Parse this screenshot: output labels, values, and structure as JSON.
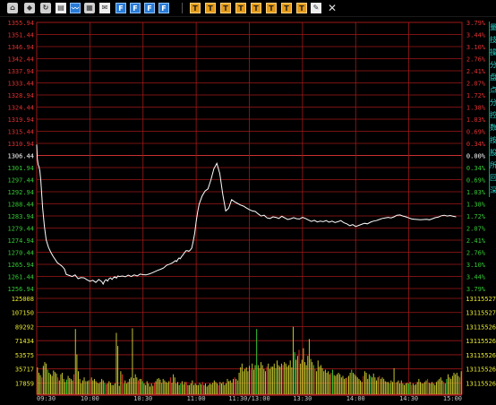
{
  "toolbar": {
    "buttons": [
      {
        "name": "home-icon",
        "cls": "a",
        "glyph": "⌂"
      },
      {
        "name": "layers-icon",
        "cls": "a",
        "glyph": "◆"
      },
      {
        "name": "refresh-icon",
        "cls": "a",
        "glyph": "↻"
      },
      {
        "name": "document-icon",
        "cls": "w",
        "glyph": "▤"
      },
      {
        "name": "chart-view-icon",
        "cls": "b",
        "glyph": "〰"
      },
      {
        "name": "grid-icon",
        "cls": "a",
        "glyph": "▦"
      },
      {
        "name": "mail-icon",
        "cls": "w",
        "glyph": "✉"
      },
      {
        "name": "f1-icon",
        "cls": "b",
        "glyph": "F"
      },
      {
        "name": "f2-icon",
        "cls": "b",
        "glyph": "F"
      },
      {
        "name": "f3-icon",
        "cls": "b",
        "glyph": "F"
      },
      {
        "name": "f4-icon",
        "cls": "b",
        "glyph": "F"
      },
      {
        "name": "tool-1-icon",
        "cls": "o",
        "glyph": "T"
      },
      {
        "name": "tool-2-icon",
        "cls": "o",
        "glyph": "T"
      },
      {
        "name": "tool-3-icon",
        "cls": "o",
        "glyph": "T"
      },
      {
        "name": "tool-4-icon",
        "cls": "o",
        "glyph": "T"
      },
      {
        "name": "tool-5-icon",
        "cls": "o",
        "glyph": "T"
      },
      {
        "name": "tool-6-icon",
        "cls": "o",
        "glyph": "T"
      },
      {
        "name": "tool-7-icon",
        "cls": "o",
        "glyph": "T"
      },
      {
        "name": "tool-8-icon",
        "cls": "o",
        "glyph": "T"
      },
      {
        "name": "tool-9-icon",
        "cls": "o",
        "glyph": "T"
      },
      {
        "name": "pencil-icon",
        "cls": "w",
        "glyph": "✎"
      },
      {
        "name": "close-icon",
        "cls": "x",
        "glyph": "✕"
      }
    ]
  },
  "side_tabs": [
    "量",
    "技",
    "操",
    "分",
    "盘",
    "点",
    "分",
    "控",
    "数",
    "按",
    "股",
    "所",
    "回",
    "深"
  ],
  "colors": {
    "up": "#e03030",
    "down": "#35c835",
    "grid": "#a01818",
    "price_line": "#ffffff",
    "volume_bar": "#c8c830",
    "volume_up": "#e03030",
    "volume_down": "#35c835",
    "reference": "#ffffff"
  },
  "chart_data": [
    {
      "type": "line",
      "name": "price",
      "reference_price": 1306.44,
      "left_ticks": [
        "1355.94",
        "1351.44",
        "1346.94",
        "1342.44",
        "1337.94",
        "1333.44",
        "1328.94",
        "1324.44",
        "1319.94",
        "1315.44",
        "1310.94",
        "1306.44",
        "1301.94",
        "1297.44",
        "1292.94",
        "1288.44",
        "1283.94",
        "1279.44",
        "1274.94",
        "1270.44",
        "1265.94",
        "1261.44",
        "1256.94"
      ],
      "right_ticks": [
        "3.79%",
        "3.44%",
        "3.10%",
        "2.76%",
        "2.41%",
        "2.07%",
        "1.72%",
        "1.38%",
        "1.03%",
        "0.69%",
        "0.34%",
        "0.00%",
        "0.34%",
        "0.69%",
        "1.03%",
        "1.38%",
        "1.72%",
        "2.07%",
        "2.41%",
        "2.76%",
        "3.10%",
        "3.44%",
        "3.79%"
      ],
      "ylim": [
        1256.94,
        1355.94
      ],
      "x_ticks": [
        "09:30",
        "10:00",
        "10:30",
        "11:00",
        "11:30/13:00",
        "13:30",
        "14:00",
        "14:30",
        "15:00"
      ],
      "x": [
        0,
        2,
        5,
        8,
        11,
        14,
        20,
        26,
        32,
        40,
        48,
        55,
        62,
        70,
        78,
        86,
        94,
        100,
        110,
        120,
        130,
        140,
        150,
        160,
        170,
        180,
        190,
        200,
        210,
        220,
        225,
        230,
        235,
        240,
        245,
        250,
        255,
        260,
        265,
        270,
        275,
        280,
        290,
        300,
        310,
        320,
        330,
        340,
        350,
        360,
        370,
        380,
        390,
        400,
        410,
        420,
        430,
        440,
        450,
        460,
        470,
        474,
        478,
        482,
        486,
        490,
        494,
        498,
        502,
        506,
        510,
        515,
        520,
        525,
        530,
        535,
        540,
        545,
        550,
        560,
        570,
        580,
        590,
        600,
        610,
        620,
        630,
        640,
        650,
        660,
        670,
        680,
        690,
        700,
        710,
        720,
        730,
        740,
        750,
        760,
        770,
        780,
        790,
        800,
        810,
        820,
        830,
        840,
        850,
        860,
        870,
        880,
        890,
        900,
        910,
        920,
        930,
        940,
        950,
        960,
        970,
        980,
        990,
        1000,
        1010,
        1020,
        1030,
        1040,
        1050,
        1060,
        1070,
        1080,
        1090,
        1100,
        1110,
        1120,
        1130,
        1140,
        1150,
        1160,
        1170,
        1180,
        1190,
        1200,
        1210,
        1220,
        1230,
        1240,
        1250,
        1260,
        1270,
        1280,
        1290,
        1300,
        1310,
        1320,
        1330,
        1340,
        1350,
        1360,
        1370,
        1380,
        1390,
        1400,
        1410,
        1420,
        1430,
        1440
      ],
      "price": [
        1310.5,
        1305.2,
        1303.0,
        1302.2,
        1300.5,
        1297.0,
        1287.0,
        1280.0,
        1275.0,
        1272.2,
        1270.4,
        1269.0,
        1267.8,
        1266.5,
        1265.9,
        1265.2,
        1264.2,
        1262.2,
        1261.8,
        1261.4,
        1262.0,
        1260.6,
        1261.0,
        1260.9,
        1260.2,
        1259.6,
        1260.0,
        1259.2,
        1260.3,
        1259.5,
        1258.6,
        1259.8,
        1260.2,
        1259.7,
        1260.6,
        1260.9,
        1260.3,
        1261.0,
        1261.3,
        1260.8,
        1261.6,
        1261.4,
        1261.6,
        1261.3,
        1261.9,
        1261.4,
        1262.0,
        1261.6,
        1262.3,
        1262.1,
        1262.0,
        1262.3,
        1262.7,
        1263.2,
        1263.7,
        1264.1,
        1264.6,
        1265.6,
        1266.0,
        1266.5,
        1267.3,
        1267.0,
        1267.8,
        1268.3,
        1268.0,
        1268.7,
        1269.3,
        1269.9,
        1270.5,
        1271.0,
        1271.0,
        1270.8,
        1271.2,
        1272.0,
        1274.5,
        1277.6,
        1281.8,
        1285.5,
        1288.3,
        1291.3,
        1293.2,
        1294.0,
        1297.4,
        1301.5,
        1303.5,
        1299.7,
        1292.0,
        1285.8,
        1286.8,
        1290.0,
        1289.2,
        1288.6,
        1288.0,
        1287.6,
        1286.9,
        1286.3,
        1285.8,
        1285.6,
        1284.7,
        1283.9,
        1284.2,
        1283.2,
        1283.0,
        1283.6,
        1283.4,
        1283.0,
        1283.8,
        1283.2,
        1282.6,
        1282.9,
        1283.3,
        1282.9,
        1282.8,
        1283.4,
        1283.0,
        1282.4,
        1281.9,
        1282.3,
        1281.7,
        1282.0,
        1281.8,
        1282.2,
        1281.6,
        1282.0,
        1281.5,
        1281.8,
        1282.2,
        1281.4,
        1281.0,
        1280.3,
        1280.7,
        1280.0,
        1280.4,
        1280.8,
        1281.2,
        1281.0,
        1281.6,
        1282.0,
        1282.2,
        1282.6,
        1283.0,
        1283.2,
        1283.4,
        1283.2,
        1283.6,
        1284.2,
        1284.3,
        1283.9,
        1283.6,
        1283.2,
        1282.8,
        1282.7,
        1282.6,
        1282.5,
        1282.6,
        1282.7,
        1282.5,
        1282.9,
        1283.3,
        1283.5,
        1284.0,
        1284.2,
        1283.9,
        1284.1,
        1283.8,
        1283.6
      ]
    },
    {
      "type": "bar",
      "name": "volume",
      "ylim": [
        0,
        125008
      ],
      "left_ticks": [
        "125008",
        "107150",
        "89292",
        "71434",
        "53575",
        "35717",
        "17859"
      ],
      "right_ticks": [
        "13115527",
        "13115527",
        "13115526",
        "13115526",
        "13115526",
        "13115526",
        "13115526"
      ],
      "values": [
        35000,
        28000,
        25000,
        22000,
        37000,
        42000,
        40000,
        32000,
        28000,
        26000,
        24000,
        31000,
        29000,
        27000,
        22000,
        18000,
        26000,
        28000,
        20000,
        16000,
        19000,
        24000,
        21000,
        20000,
        18000,
        26000,
        85000,
        52000,
        30000,
        20000,
        14000,
        18000,
        22000,
        17000,
        17000,
        18000,
        19000,
        22000,
        18000,
        20000,
        17000,
        15000,
        14000,
        16000,
        20000,
        18000,
        15000,
        13000,
        14000,
        17000,
        15000,
        12000,
        12000,
        14000,
        80000,
        63000,
        11000,
        30000,
        26000,
        14000,
        18000,
        14000,
        16000,
        20000,
        22000,
        86000,
        21000,
        26000,
        22000,
        18000,
        20000,
        20000,
        17000,
        14000,
        12000,
        17000,
        14000,
        10000,
        14000,
        11000,
        15000,
        17000,
        20000,
        21000,
        19000,
        15000,
        20000,
        18000,
        16000,
        15000,
        17000,
        22000,
        15000,
        26000,
        22000,
        14000,
        16000,
        12000,
        14000,
        17000,
        13000,
        16000,
        16000,
        12000,
        12000,
        14000,
        18000,
        12000,
        14000,
        12000,
        12000,
        15000,
        13000,
        16000,
        12000,
        14000,
        10000,
        12000,
        14000,
        13000,
        15000,
        18000,
        16000,
        14000,
        12000,
        16000,
        14000,
        16000,
        12000,
        14000,
        20000,
        17000,
        18000,
        15000,
        20000,
        22000,
        20000,
        18000,
        28000,
        35000,
        40000,
        30000,
        33000,
        35000,
        30000,
        37000,
        32000,
        40000,
        32000,
        38000,
        85000,
        38000,
        34000,
        42000,
        38000,
        33000,
        30000,
        36000,
        40000,
        33000,
        36000,
        36000,
        40000,
        34000,
        44000,
        38000,
        36000,
        40000,
        38000,
        42000,
        40000,
        36000,
        38000,
        44000,
        35000,
        88000,
        55000,
        45000,
        50000,
        58000,
        40000,
        45000,
        60000,
        42000,
        38000,
        50000,
        72000,
        46000,
        42000,
        38000,
        33000,
        30000,
        44000,
        36000,
        38000,
        34000,
        30000,
        32000,
        28000,
        30000,
        26000,
        28000,
        32000,
        25000,
        24000,
        26000,
        28000,
        26000,
        22000,
        24000,
        20000,
        21000,
        22000,
        24000,
        28000,
        32000,
        28000,
        26000,
        24000,
        22000,
        20000,
        18000,
        16000,
        24000,
        30000,
        28000,
        20000,
        26000,
        24000,
        22000,
        27000,
        22000,
        18000,
        22000,
        24000,
        20000,
        22000,
        20000,
        17000,
        16000,
        16000,
        14000,
        18000,
        16000,
        34000,
        15000,
        16000,
        18000,
        14000,
        18000,
        14000,
        12000,
        14000,
        15000,
        14000,
        16000,
        12000,
        14000,
        12000,
        13000,
        16000,
        20000,
        16000,
        14000,
        14000,
        16000,
        18000,
        20000,
        15000,
        14000,
        16000,
        14000,
        12000,
        16000,
        18000,
        20000,
        22000,
        18000,
        16000,
        14000,
        20000,
        26000,
        22000,
        20000,
        24000,
        28000,
        26000,
        28000,
        24000,
        22000,
        30000
      ]
    }
  ]
}
